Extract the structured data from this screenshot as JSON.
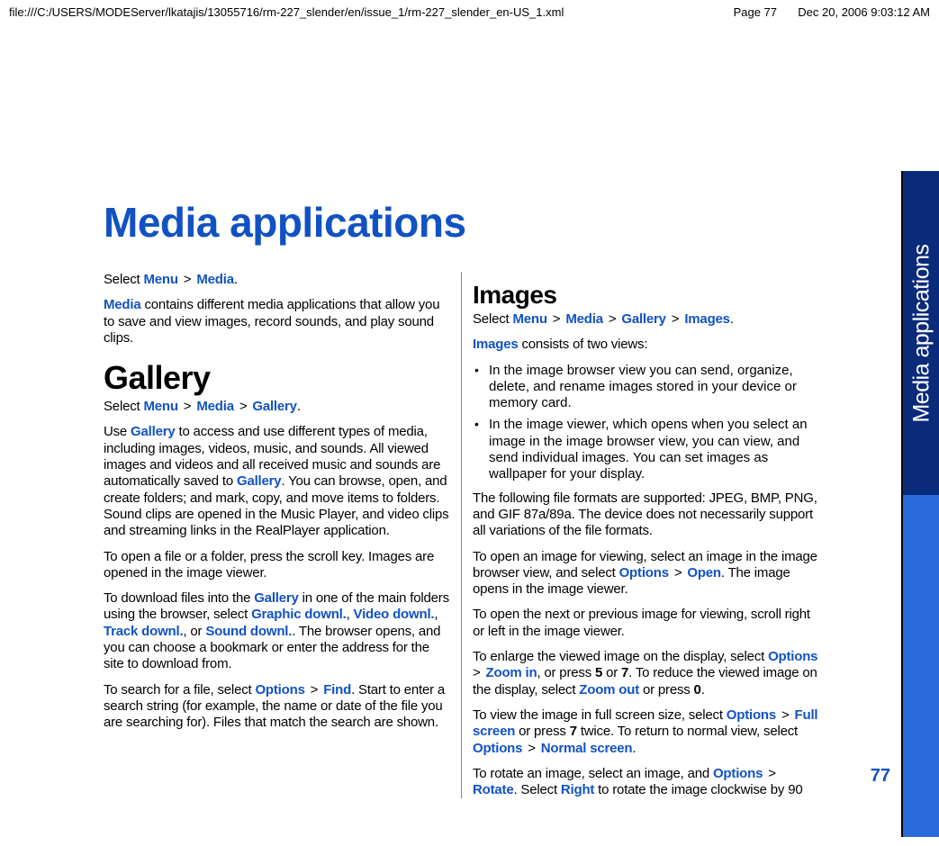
{
  "header": {
    "path": "file:///C:/USERS/MODEServer/lkatajis/13055716/rm-227_slender/en/issue_1/rm-227_slender_en-US_1.xml",
    "page": "Page 77",
    "date": "Dec 20, 2006 9:03:12 AM"
  },
  "title": "Media applications",
  "side_tab": "Media applications",
  "page_number": "77",
  "left": {
    "intro_select_prefix": "Select ",
    "intro_menu": "Menu",
    "intro_media": "Media",
    "intro_para_a": "Media",
    "intro_para_b": " contains different media applications that allow you to save and view images, record sounds, and play sound clips.",
    "gallery_h": "Gallery",
    "g_select_prefix": "Select ",
    "g_menu": "Menu",
    "g_media": "Media",
    "g_gallery": "Gallery",
    "g_use_a": "Use ",
    "g_use_b": "Gallery",
    "g_use_c": " to access and use different types of media, including images, videos, music, and sounds. All viewed images and videos and all received music and sounds are automatically saved to ",
    "g_use_d": "Gallery",
    "g_use_e": ". You can browse, open, and create folders; and mark, copy, and move items to folders. Sound clips are opened in the Music Player, and video clips and streaming links in the RealPlayer application.",
    "g_open": "To open a file or a folder, press the scroll key. Images are opened in the image viewer.",
    "g_dl_a": "To download files into the ",
    "g_dl_b": "Gallery",
    "g_dl_c": " in one of the main folders using the browser, select ",
    "g_dl_d": "Graphic downl.",
    "g_dl_e": ", ",
    "g_dl_f": "Video downl.",
    "g_dl_g": ", ",
    "g_dl_h": "Track downl.",
    "g_dl_i": ", or ",
    "g_dl_j": "Sound downl.",
    "g_dl_k": ". The browser opens, and you can choose a bookmark or enter the address for the site to download from.",
    "g_search_a": "To search for a file, select ",
    "g_search_b": "Options",
    "g_search_c": "Find",
    "g_search_d": ". Start to enter a search string (for example, the name or date of the file you are searching for). Files that match the search are shown."
  },
  "right": {
    "images_h": "Images",
    "i_select_prefix": "Select ",
    "i_menu": "Menu",
    "i_media": "Media",
    "i_gallery": "Gallery",
    "i_images": "Images",
    "i_consists_a": "Images",
    "i_consists_b": " consists of two views:",
    "bullet1": "In the image browser view you can send, organize, delete, and rename images stored in your device or memory card.",
    "bullet2": "In the image viewer, which opens when you select an image in the image browser view, you can view, and send individual images. You can set images as wallpaper for your display.",
    "formats": "The following file formats are supported: JPEG, BMP, PNG, and GIF 87a/89a. The device does not necessarily support all variations of the file formats.",
    "open_a": "To open an image for viewing, select an image in the image browser view, and select ",
    "open_b": "Options",
    "open_c": "Open",
    "open_d": ". The image opens in the image viewer.",
    "next": "To open the next or previous image for viewing, scroll right or left in the image viewer.",
    "zoom_a": "To enlarge the viewed image on the display, select ",
    "zoom_b": "Options",
    "zoom_c": "Zoom in",
    "zoom_d": ", or press ",
    "zoom_e": "5",
    "zoom_f": " or ",
    "zoom_g": "7",
    "zoom_h": ". To reduce the viewed image on the display, select ",
    "zoom_i": "Zoom out",
    "zoom_j": " or press ",
    "zoom_k": "0",
    "zoom_l": ".",
    "full_a": "To view the image in full screen size, select ",
    "full_b": "Options",
    "full_c": "Full screen",
    "full_d": " or press ",
    "full_e": "7",
    "full_f": " twice. To return to normal view, select ",
    "full_g": "Options",
    "full_h": "Normal screen",
    "full_i": ".",
    "rot_a": "To rotate an image, select an image, and ",
    "rot_b": "Options",
    "rot_c": "Rotate",
    "rot_d": ". Select ",
    "rot_e": "Right",
    "rot_f": " to rotate the image clockwise by 90"
  }
}
